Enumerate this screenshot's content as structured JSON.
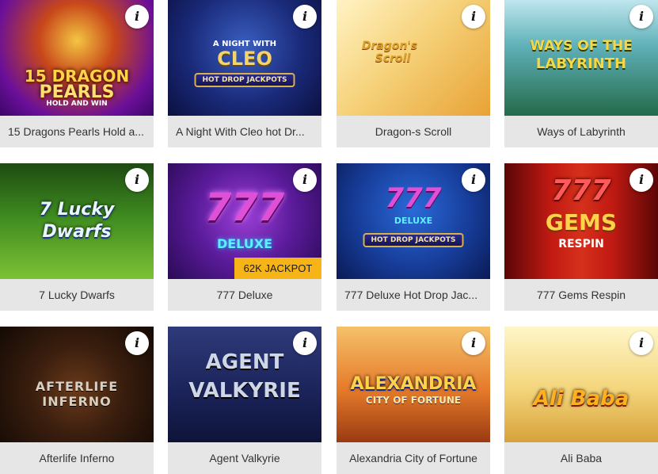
{
  "games": [
    {
      "title": "15 Dragons Pearls Hold a...",
      "art_top": "15 DRAGON",
      "art_mid": "PEARLS",
      "art_sub": "HOLD AND WIN"
    },
    {
      "title": "A Night With Cleo hot Dr...",
      "art_top": "A NIGHT WITH",
      "art_mid": "CLEO",
      "art_sub": "HOT DROP JACKPOTS"
    },
    {
      "title": "Dragon-s Scroll",
      "art_top": "Dragon's",
      "art_mid": "Scroll"
    },
    {
      "title": "Ways of Labyrinth",
      "art_top": "WAYS OF THE",
      "art_mid": "LABYRINTH"
    },
    {
      "title": "7 Lucky Dwarfs",
      "art_top": "7 Lucky",
      "art_mid": "Dwarfs"
    },
    {
      "title": "777 Deluxe",
      "art_top": "777",
      "art_mid": "DELUXE",
      "jackpot": "62K JACKPOT"
    },
    {
      "title": "777 Deluxe Hot Drop Jac...",
      "art_top": "777",
      "art_mid": "DELUXE",
      "art_sub": "HOT DROP JACKPOTS"
    },
    {
      "title": "777 Gems Respin",
      "art_top": "777",
      "art_mid": "GEMS",
      "art_sub": "RESPIN"
    },
    {
      "title": "Afterlife Inferno",
      "art_top": "AFTERLIFE INFERNO"
    },
    {
      "title": "Agent Valkyrie",
      "art_top": "AGENT",
      "art_mid": "VALKYRIE"
    },
    {
      "title": "Alexandria City of Fortune",
      "art_top": "ALEXANDRIA",
      "art_mid": "CITY OF FORTUNE"
    },
    {
      "title": "Ali Baba",
      "art_top": "Ali Baba"
    }
  ],
  "info_label": "i",
  "icons": {
    "info": "info-icon"
  },
  "colors": {
    "caption_bg": "#e6e6e6",
    "jackpot_bg": "#f7b416",
    "caption_text": "#333333"
  }
}
